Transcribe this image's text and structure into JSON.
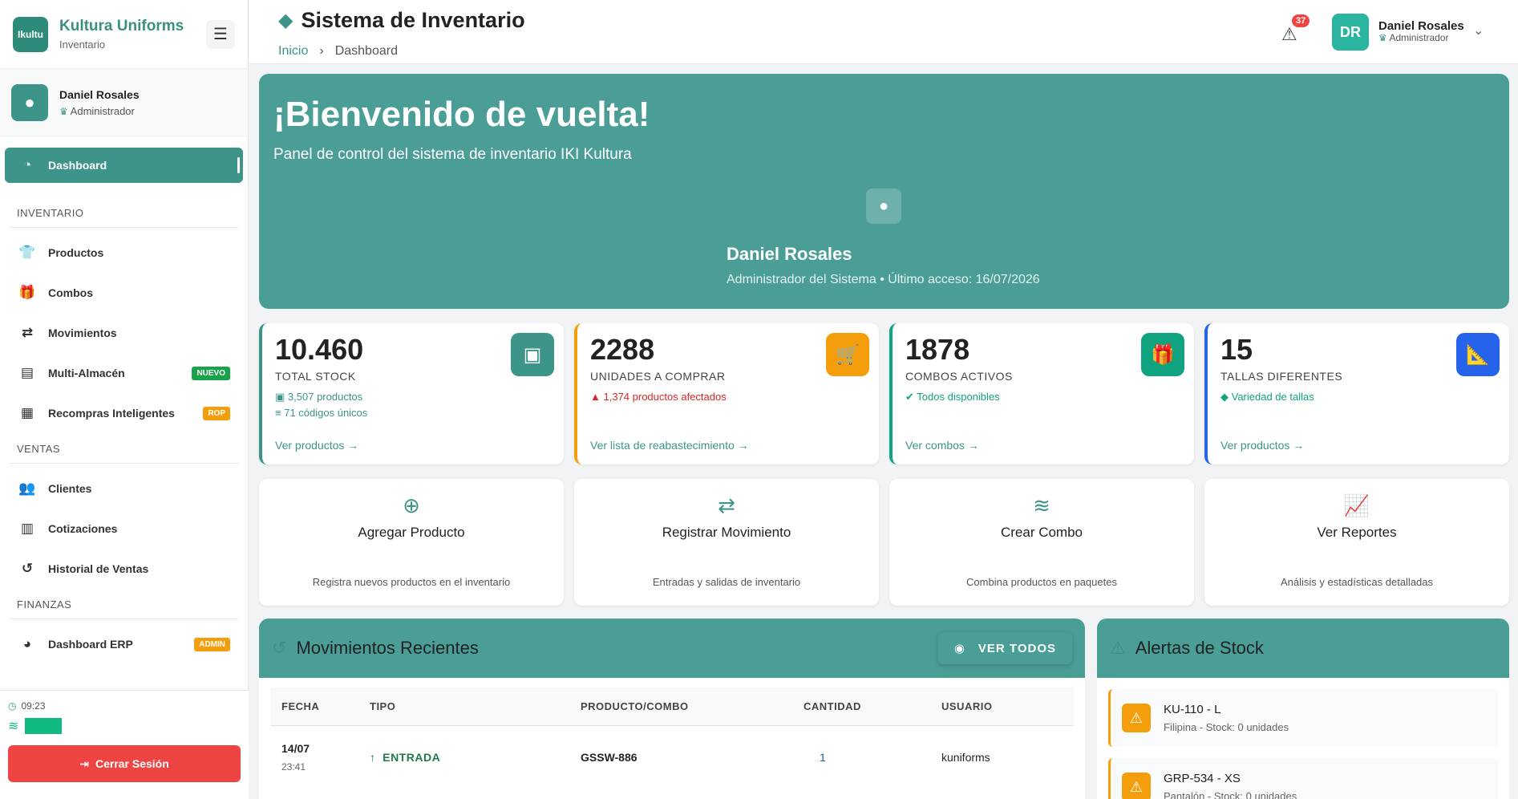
{
  "sidebar": {
    "logo_text": "Ikultu",
    "brand_title": "Kultura Uniforms",
    "brand_sub": "Inventario",
    "user_name": "Daniel Rosales",
    "user_role": "Administrador",
    "active_item": "Dashboard",
    "sections": {
      "inventario": "INVENTARIO",
      "ventas": "VENTAS",
      "finanzas": "FINANZAS"
    },
    "items": {
      "productos": "Productos",
      "combos": "Combos",
      "movimientos": "Movimientos",
      "multi_almacen": "Multi-Almacén",
      "multi_almacen_badge": "NUEVO",
      "recompras": "Recompras Inteligentes",
      "recompras_badge": "ROP",
      "clientes": "Clientes",
      "cotizaciones": "Cotizaciones",
      "historial": "Historial de Ventas",
      "dashboard_erp": "Dashboard ERP",
      "dashboard_erp_badge": "ADMIN"
    },
    "time": "09:23",
    "logout": "Cerrar Sesión"
  },
  "header": {
    "title": "Sistema de Inventario",
    "breadcrumb_home": "Inicio",
    "breadcrumb_current": "Dashboard",
    "alert_count": "37",
    "avatar_initials": "DR",
    "profile_name": "Daniel Rosales",
    "profile_role": "Administrador"
  },
  "hero": {
    "title": "¡Bienvenido de vuelta!",
    "subtitle": "Panel de control del sistema de inventario IKI Kultura",
    "name": "Daniel Rosales",
    "meta": "Administrador del Sistema • Último acceso: 16/07/2026"
  },
  "stats": [
    {
      "value": "10.460",
      "label": "TOTAL STOCK",
      "detail1": "3,507 productos",
      "detail2": "71 códigos únicos",
      "link": "Ver productos →",
      "color": "#3d9489"
    },
    {
      "value": "2288",
      "label": "UNIDADES A COMPRAR",
      "detail1": "1,374 productos afectados",
      "link": "Ver lista de reabastecimiento →",
      "color": "#f59e0b"
    },
    {
      "value": "1878",
      "label": "COMBOS ACTIVOS",
      "detail1": "Todos disponibles",
      "link": "Ver combos →",
      "color": "#10a37f"
    },
    {
      "value": "15",
      "label": "TALLAS DIFERENTES",
      "detail1": "Variedad de tallas",
      "link": "Ver productos →",
      "color": "#2563eb"
    }
  ],
  "actions": [
    {
      "title": "Agregar Producto",
      "desc": "Registra nuevos productos en el inventario"
    },
    {
      "title": "Registrar Movimiento",
      "desc": "Entradas y salidas de inventario"
    },
    {
      "title": "Crear Combo",
      "desc": "Combina productos en paquetes"
    },
    {
      "title": "Ver Reportes",
      "desc": "Análisis y estadísticas detalladas"
    }
  ],
  "movimientos": {
    "title": "Movimientos Recientes",
    "button": "VER TODOS",
    "headers": [
      "FECHA",
      "TIPO",
      "PRODUCTO/COMBO",
      "CANTIDAD",
      "USUARIO"
    ],
    "rows": [
      {
        "date": "14/07",
        "time": "23:41",
        "tipo": "ENTRADA",
        "producto": "GSSW-886",
        "cantidad": "1",
        "usuario": "kuniforms"
      }
    ]
  },
  "alertas": {
    "title": "Alertas de Stock",
    "items": [
      {
        "code": "KU-110 - L",
        "desc": "Filipina - Stock: 0 unidades"
      },
      {
        "code": "GRP-534 - XS",
        "desc": "Pantalón - Stock: 0 unidades"
      }
    ]
  }
}
